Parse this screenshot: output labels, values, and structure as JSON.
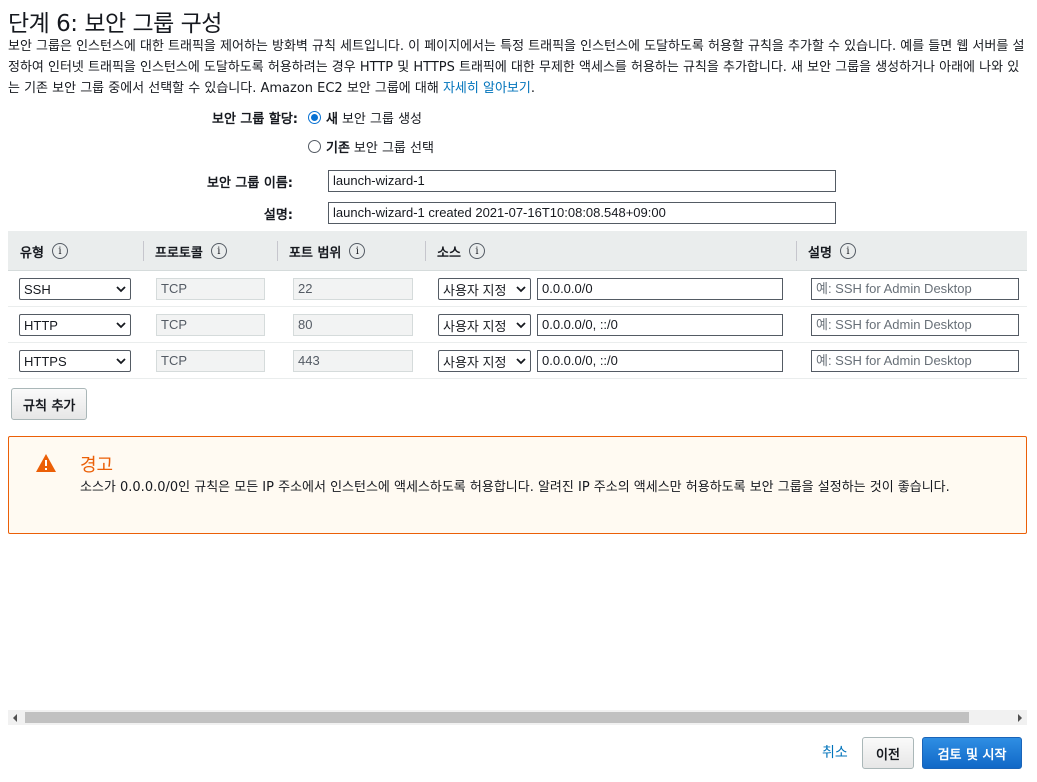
{
  "page": {
    "title": "단계 6: 보안 그룹 구성",
    "intro": "보안 그룹은 인스턴스에 대한 트래픽을 제어하는 방화벽 규칙 세트입니다. 이 페이지에서는 특정 트래픽을 인스턴스에 도달하도록 허용할 규칙을 추가할 수 있습니다. 예를 들면 웹 서버를 설정하여 인터넷 트래픽을 인스턴스에 도달하도록 허용하려는 경우 HTTP 및 HTTPS 트래픽에 대한 무제한 액세스를 허용하는 규칙을 추가합니다. 새 보안 그룹을 생성하거나 아래에 나와 있는 기존 보안 그룹 중에서 선택할 수 있습니다. Amazon EC2 보안 그룹에 대해 ",
    "learn_more": "자세히 알아보기",
    "intro_end": "."
  },
  "assign": {
    "label": "보안 그룹 할당:",
    "option_new_bold": "새",
    "option_new_rest": "보안 그룹 생성",
    "option_existing_bold": "기존",
    "option_existing_rest": "보안 그룹 선택",
    "selected": "new"
  },
  "name_field": {
    "label": "보안 그룹 이름:",
    "value": "launch-wizard-1"
  },
  "desc_field": {
    "label": "설명:",
    "value": "launch-wizard-1 created 2021-07-16T10:08:08.548+09:00"
  },
  "table": {
    "headers": [
      "유형",
      "프로토콜",
      "포트 범위",
      "소스",
      "설명"
    ],
    "info_glyph": "i",
    "rows": [
      {
        "type": "SSH",
        "protocol": "TCP",
        "port": "22",
        "source_type": "사용자 지정",
        "source": "0.0.0.0/0",
        "description_placeholder": "예: SSH for Admin Desktop"
      },
      {
        "type": "HTTP",
        "protocol": "TCP",
        "port": "80",
        "source_type": "사용자 지정",
        "source": "0.0.0.0/0, ::/0",
        "description_placeholder": "예: SSH for Admin Desktop"
      },
      {
        "type": "HTTPS",
        "protocol": "TCP",
        "port": "443",
        "source_type": "사용자 지정",
        "source": "0.0.0.0/0, ::/0",
        "description_placeholder": "예: SSH for Admin Desktop"
      }
    ]
  },
  "add_rule_label": "규칙 추가",
  "alert": {
    "title": "경고",
    "body": "소스가 0.0.0.0/0인 규칙은 모든 IP 주소에서 인스턴스에 액세스하도록 허용합니다. 알려진 IP 주소의 액세스만 허용하도록 보안 그룹을 설정하는 것이 좋습니다.",
    "color": "#eb5f07"
  },
  "footer": {
    "cancel": "취소",
    "previous": "이전",
    "review_launch": "검토 및 시작"
  },
  "colors": {
    "primary": "#0972d3",
    "link": "#0073bb",
    "warning": "#eb5f07"
  }
}
